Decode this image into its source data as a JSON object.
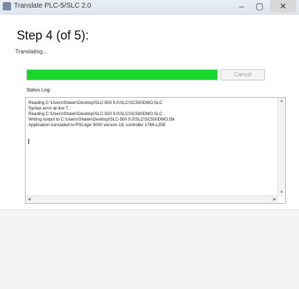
{
  "window": {
    "title": "Translate PLC-5/SLC 2.0",
    "minimize": "–",
    "maximize": "▢",
    "close": "✕"
  },
  "step": {
    "heading": "Step 4 (of 5):",
    "status": "Translating..."
  },
  "progress": {
    "value_percent": 100,
    "color": "#17d62c"
  },
  "cancel": {
    "label": "Cancel"
  },
  "log": {
    "label": "Status Log:",
    "lines": [
      "Reading C:\\Users\\Shawn\\Desktop\\SLC-500 9.0\\SLC\\SC500DMO.SLC",
      "Syntax error at line 7.",
      "Reading C:\\Users\\Shawn\\Desktop\\SLC-500 9.0\\SLC\\SC500DMO.SLC",
      "Writing output to C:\\Users\\Shawn\\Desktop\\SLC-500 9.0\\SLC\\SC500DMO.l5k",
      "Application translated to RSLogix 5000 version 18, controller 1769-L35E"
    ]
  },
  "icons": {
    "app": "app-icon",
    "scroll_up": "▲",
    "scroll_down": "▼",
    "scroll_left": "◀",
    "scroll_right": "▶"
  }
}
